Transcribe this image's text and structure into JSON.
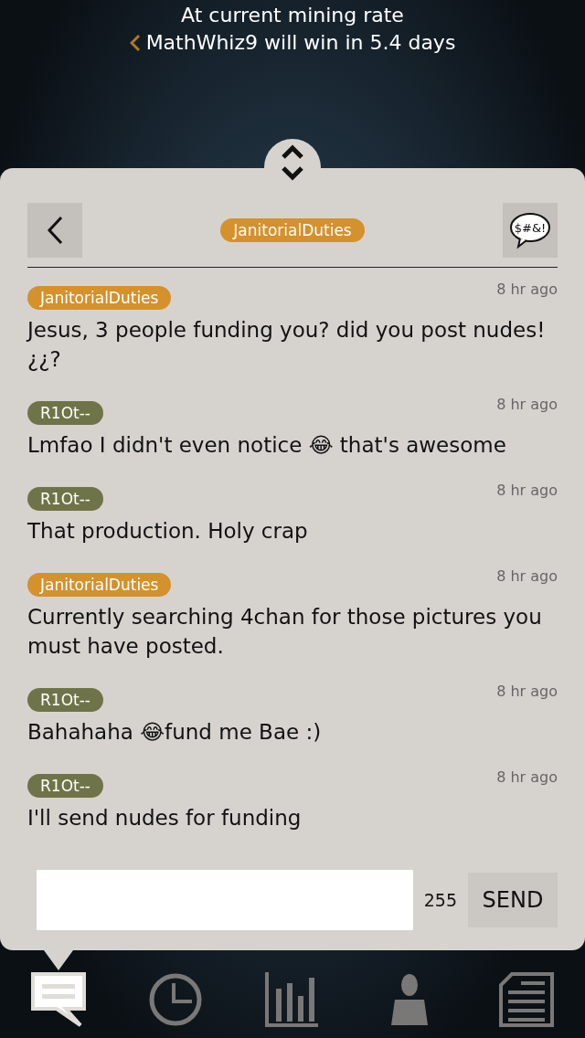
{
  "banner": {
    "line_1": "At current mining rate",
    "line_2": "MathWhiz9 will win in 5.4 days"
  },
  "chat": {
    "title": {
      "name": "JanitorialDuties",
      "color": "#d4912c"
    },
    "messages": [
      {
        "user": "JanitorialDuties",
        "color": "#d4912c",
        "time": "8 hr ago",
        "text": "Jesus, 3 people funding you? did you post nudes! ¿¿?"
      },
      {
        "user": "R1Ot--",
        "color": "#6f7448",
        "time": "8 hr ago",
        "text": "Lmfao I didn't even notice 😂 that's awesome"
      },
      {
        "user": "R1Ot--",
        "color": "#6f7448",
        "time": "8 hr ago",
        "text": "That production. Holy crap"
      },
      {
        "user": "JanitorialDuties",
        "color": "#d4912c",
        "time": "8 hr ago",
        "text": "Currently searching 4chan for those pictures you must have posted."
      },
      {
        "user": "R1Ot--",
        "color": "#6f7448",
        "time": "8 hr ago",
        "text": "Bahahaha 😂fund me Bae :)"
      },
      {
        "user": "R1Ot--",
        "color": "#6f7448",
        "time": "8 hr ago",
        "text": "I'll send nudes for funding"
      }
    ],
    "filter_label": "$#&!",
    "composer": {
      "count": "255",
      "send": "SEND"
    }
  },
  "nav": [
    {
      "kind": "chat",
      "selected": true
    },
    {
      "kind": "clock",
      "selected": false
    },
    {
      "kind": "chart",
      "selected": false
    },
    {
      "kind": "person",
      "selected": false
    },
    {
      "kind": "document",
      "selected": false
    }
  ]
}
